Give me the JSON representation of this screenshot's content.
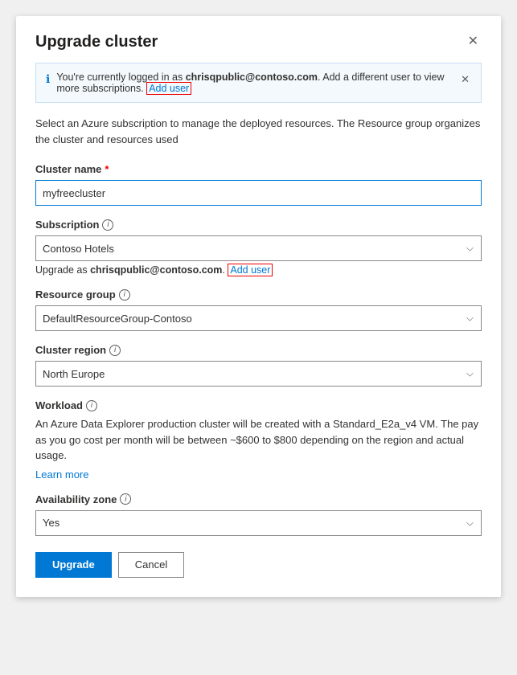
{
  "dialog": {
    "title": "Upgrade cluster",
    "close_label": "✕"
  },
  "banner": {
    "text_before": "You're currently logged in as ",
    "email": "chrisqpublic@contoso.com",
    "text_after": ". Add a different user to view more subscriptions.",
    "add_user_label": "Add user",
    "close_label": "✕"
  },
  "description": "Select an Azure subscription to manage the deployed resources. The Resource group organizes the cluster and resources used",
  "fields": {
    "cluster_name": {
      "label": "Cluster name",
      "required": true,
      "value": "myfreecluster"
    },
    "subscription": {
      "label": "Subscription",
      "value": "Contoso Hotels",
      "note_before": "Upgrade as ",
      "note_email": "chrisqpublic@contoso.com",
      "note_add_user": "Add user"
    },
    "resource_group": {
      "label": "Resource group",
      "value": "DefaultResourceGroup-Contoso"
    },
    "cluster_region": {
      "label": "Cluster region",
      "value": "North Europe"
    },
    "workload": {
      "label": "Workload",
      "description": "An Azure Data Explorer production cluster will be created with a Standard_E2a_v4 VM. The pay as you go cost per month will be between ~$600 to $800 depending on the region and actual usage.",
      "learn_more": "Learn more"
    },
    "availability_zone": {
      "label": "Availability zone",
      "value": "Yes"
    }
  },
  "footer": {
    "upgrade_label": "Upgrade",
    "cancel_label": "Cancel"
  },
  "icons": {
    "info": "ℹ",
    "chevron_down": "⌄",
    "close": "✕"
  }
}
